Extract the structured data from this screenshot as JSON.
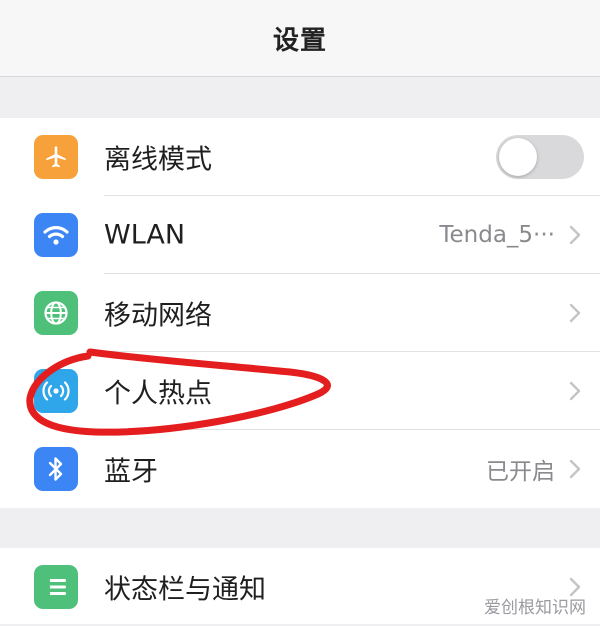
{
  "header": {
    "title": "设置"
  },
  "settings": {
    "group1": [
      {
        "label": "离线模式",
        "icon": "airplane-icon",
        "color": "#f7a13a",
        "toggle": false
      },
      {
        "label": "WLAN",
        "icon": "wifi-icon",
        "color": "#3b85f5",
        "value": "Tenda_5···"
      },
      {
        "label": "移动网络",
        "icon": "globe-icon",
        "color": "#4ec07a"
      },
      {
        "label": "个人热点",
        "icon": "hotspot-icon",
        "color": "#2fa6e9"
      },
      {
        "label": "蓝牙",
        "icon": "bluetooth-icon",
        "color": "#3b85f5",
        "value": "已开启"
      }
    ],
    "group2": [
      {
        "label": "状态栏与通知",
        "icon": "notification-list-icon",
        "color": "#4ec07a"
      }
    ]
  },
  "annotation": {
    "color": "#e41e1e"
  },
  "watermark": {
    "text": "爱创根知识网"
  }
}
